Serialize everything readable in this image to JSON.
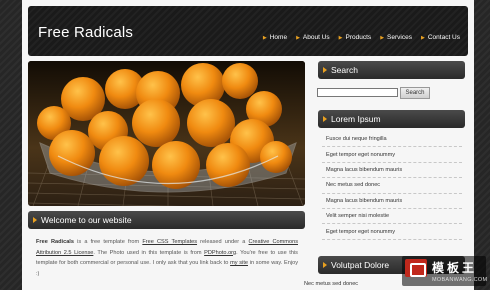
{
  "header": {
    "title": "Free Radicals",
    "nav": [
      "Home",
      "About Us",
      "Products",
      "Services",
      "Contact Us"
    ]
  },
  "welcome": {
    "title": "Welcome to our website",
    "site_name": "Free Radicals",
    "t1": " is a free template from ",
    "link1": "Free CSS Templates",
    "t2": " released under a ",
    "link2": "Creative Commons Attribution 2.5 License",
    "t3": ". The Photo used in this template is from ",
    "link3": "PDPhoto.org",
    "t4": ". You're free to use this template for both commercial or personal use. I only ask that you link back to ",
    "link4": "my site",
    "t5": " in some way. Enjoy :)"
  },
  "sidebar": {
    "search_title": "Search",
    "search_value": "",
    "search_button": "Search",
    "lorem_title": "Lorem Ipsum",
    "links": [
      "Fusce dui neque fringilla",
      "Eget tempor eget nonummy",
      "Magna lacus bibendum mauris",
      "Nec metus sed donec",
      "Magna lacus bibendum mauris",
      "Velit semper nisi molestie",
      "Eget tempor eget nonummy"
    ],
    "volutpat_title": "Volutpat Dolore",
    "partial_link": "Nec metus sed donec"
  },
  "watermark": {
    "cn": "模板王",
    "en": "MOBANWANG.COM"
  },
  "colors": {
    "accent": "#e8a020",
    "dark_bar": "#2a2a2a",
    "page_bg": "#f6f6f6"
  }
}
